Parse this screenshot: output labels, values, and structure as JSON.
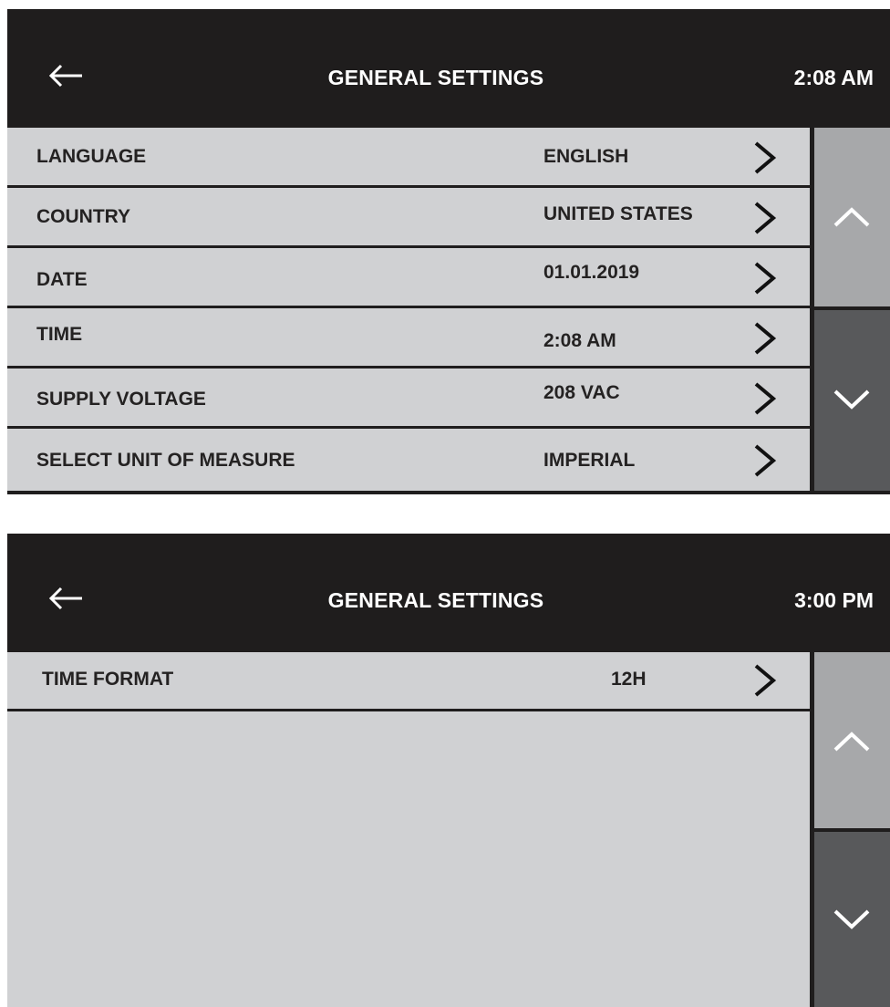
{
  "screen1": {
    "title": "GENERAL SETTINGS",
    "time": "2:08 AM",
    "back_icon": "left-arrow-icon",
    "rows": [
      {
        "label": "LANGUAGE",
        "value": "ENGLISH"
      },
      {
        "label": "COUNTRY",
        "value": "UNITED STATES"
      },
      {
        "label": "DATE",
        "value": "01.01.2019"
      },
      {
        "label": "TIME",
        "value": "2:08 AM"
      },
      {
        "label": "SUPPLY VOLTAGE",
        "value": "208 VAC"
      },
      {
        "label": "SELECT UNIT OF MEASURE",
        "value": "IMPERIAL"
      }
    ],
    "scroll_up_icon": "chevron-up-icon",
    "scroll_down_icon": "chevron-down-icon"
  },
  "screen2": {
    "title": "GENERAL SETTINGS",
    "time": "3:00 PM",
    "back_icon": "left-arrow-icon",
    "rows": [
      {
        "label": "TIME FORMAT",
        "value": "12H"
      }
    ],
    "scroll_up_icon": "chevron-up-icon",
    "scroll_down_icon": "chevron-down-icon"
  },
  "colors": {
    "header_bg": "#1f1d1d",
    "list_bg": "#d0d1d3",
    "scroll_up_bg": "#a7a8aa",
    "scroll_down_bg": "#58595b",
    "text_dark": "#242222",
    "text_light": "#ffffff"
  }
}
